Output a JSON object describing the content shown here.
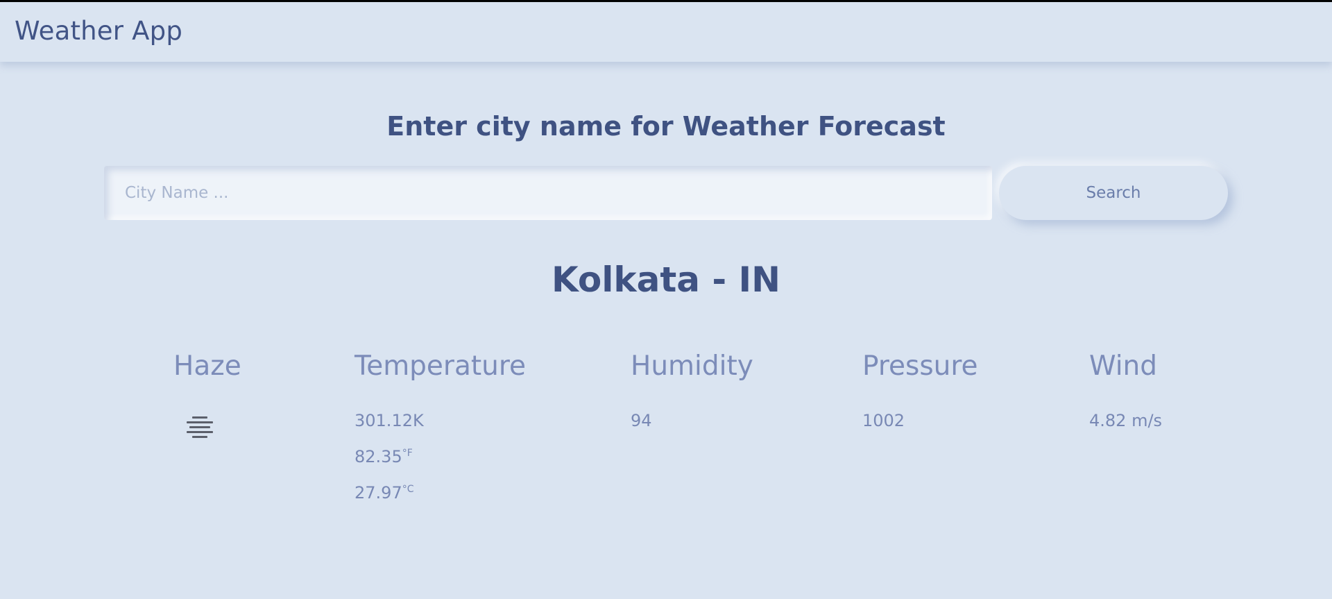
{
  "navbar": {
    "title": "Weather App"
  },
  "search": {
    "heading": "Enter city name for Weather Forecast",
    "placeholder": "City Name ...",
    "value": "",
    "button_label": "Search"
  },
  "result": {
    "city": "Kolkata - IN",
    "condition": {
      "label": "Haze",
      "icon": "haze-icon"
    },
    "temperature": {
      "label": "Temperature",
      "kelvin": "301.12K",
      "fahrenheit": "82.35",
      "fahrenheit_unit": "°F",
      "celsius": "27.97",
      "celsius_unit": "°C"
    },
    "humidity": {
      "label": "Humidity",
      "value": "94"
    },
    "pressure": {
      "label": "Pressure",
      "value": "1002"
    },
    "wind": {
      "label": "Wind",
      "value": "4.82 m/s"
    }
  }
}
